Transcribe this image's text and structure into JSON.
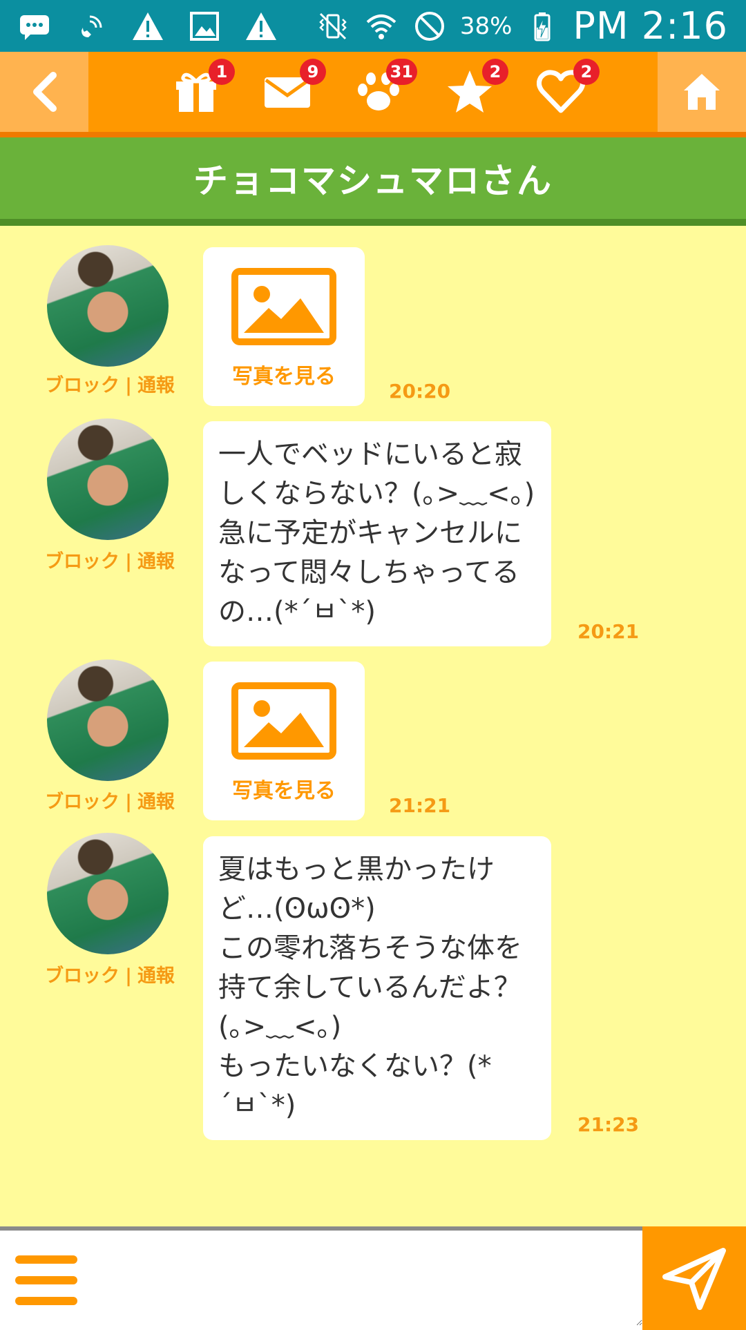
{
  "status_bar": {
    "battery": "38%",
    "time": "PM 2:16",
    "icons": [
      "chat-notification-icon",
      "wifi-calling-icon",
      "warning-icon",
      "image-icon",
      "warning-icon",
      "vibrate-icon",
      "wifi-icon",
      "do-not-disturb-icon",
      "battery-charging-icon"
    ]
  },
  "nav": {
    "badges": {
      "gift": "1",
      "mail": "9",
      "footprint": "31",
      "star": "2",
      "heart": "2"
    },
    "accent": "#FF9800"
  },
  "header": {
    "title": "チョコマシュマロさん"
  },
  "messages": [
    {
      "type": "photo",
      "photo_label": "写真を見る",
      "time": "20:20",
      "block": "ブロック",
      "sep": "|",
      "report": "通報"
    },
    {
      "type": "text",
      "text": "一人でベッドにいると寂\nしくならない？(｡>﹏<｡)\n急に予定がキャンセルに\nなって悶々しちゃってる\nの…(*´ㅂ`*)",
      "time": "20:21",
      "block": "ブロック",
      "sep": "|",
      "report": "通報"
    },
    {
      "type": "photo",
      "photo_label": "写真を見る",
      "time": "21:21",
      "block": "ブロック",
      "sep": "|",
      "report": "通報"
    },
    {
      "type": "text",
      "text": "夏はもっと黒かったけ\nど…(ʘωʘ*)\nこの零れ落ちそうな体を\n持て余しているんだよ？\n(｡>﹏<｡)\nもったいなくない？(*\n´ㅂ`*)",
      "time": "21:23",
      "block": "ブロック",
      "sep": "|",
      "report": "通報"
    }
  ],
  "input": {
    "value": ""
  }
}
